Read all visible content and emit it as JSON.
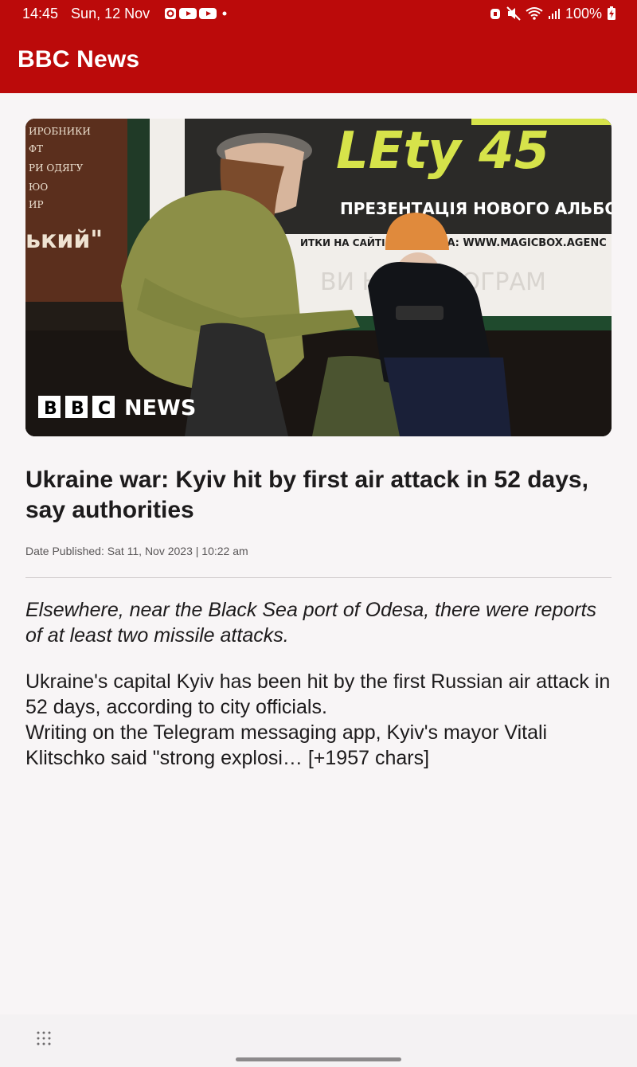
{
  "status_bar": {
    "time": "14:45",
    "date": "Sun, 12 Nov",
    "battery": "100%",
    "notification_icons": [
      "app-notification-icon",
      "youtube-icon",
      "youtube-icon",
      "more-dot-icon"
    ],
    "system_icons": [
      "alarm-icon",
      "mute-icon",
      "wifi-icon",
      "signal-icon",
      "battery-charging-icon"
    ]
  },
  "app_bar": {
    "title": "BBC News"
  },
  "article": {
    "image": {
      "logo_text": [
        "B",
        "B",
        "C",
        "NEWS"
      ],
      "poster_title": "LEty 45",
      "poster_subtitle": "ПРЕЗЕНТАЦІЯ НОВОГО АЛЬБОМУ",
      "poster_url": "ИТКИ НА САЙТІ ОР",
      "poster_url2": "РА: WWW.MAGICBOX.AGENC",
      "poster_bottom": "ВИ   НЯ ФОНОГРАМ",
      "left_sign_lines": [
        "ИРОБНИКИ",
        "ФТ",
        "РИ ОДЯГУ",
        "ЮО",
        "ИР"
      ],
      "left_sign_big": "ький\""
    },
    "headline": "Ukraine war: Kyiv hit by first air attack in 52 days, say authorities",
    "date_published": "Date Published: Sat 11, Nov 2023 | 10:22 am",
    "description": "Elsewhere, near the Black Sea port of Odesa, there were reports of at least two missile attacks.",
    "content": "Ukraine's capital Kyiv has been hit by the first Russian air attack in 52 days, according to city officials.\nWriting on the Telegram messaging app, Kyiv's mayor Vitali Klitschko said \"strong explosi… [+1957 chars]"
  },
  "colors": {
    "brand_red": "#bb0a0a",
    "background": "#f8f5f6",
    "text": "#1d1b1c"
  }
}
